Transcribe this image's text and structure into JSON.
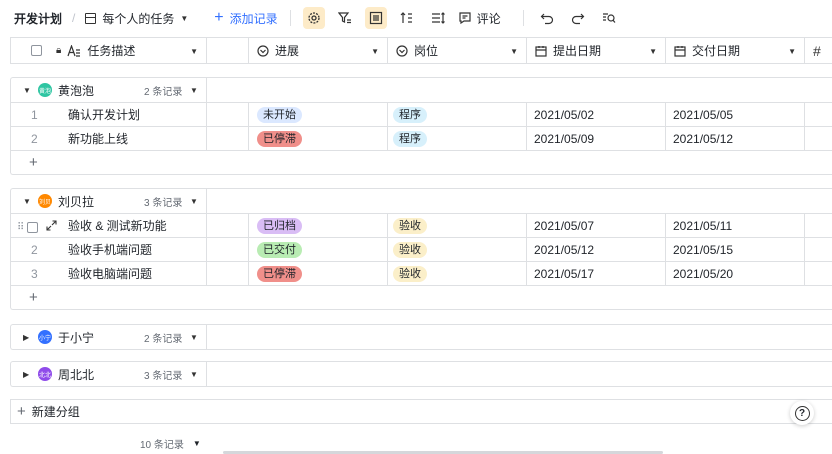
{
  "toolbar": {
    "breadcrumb": "开发计划",
    "separator": "/",
    "view_name": "每个人的任务",
    "add_record": "添加记录",
    "comment": "评论"
  },
  "columns": {
    "task": "任务描述",
    "progress": "进展",
    "role": "岗位",
    "submit_date": "提出日期",
    "deliver_date": "交付日期",
    "extra": "#"
  },
  "groups": [
    {
      "name": "黄泡泡",
      "avatar": "黄泡",
      "avatar_color": "#2ec5a2",
      "count": "2 条记录",
      "expanded": true,
      "rows": [
        {
          "num": "1",
          "task": "确认开发计划",
          "progress": "未开始",
          "progress_color": "#dbe8ff",
          "role": "程序",
          "role_color": "#d7f0fb",
          "submit": "2021/05/02",
          "deliver": "2021/05/05"
        },
        {
          "num": "2",
          "task": "新功能上线",
          "progress": "已停滞",
          "progress_color": "#f08f8a",
          "role": "程序",
          "role_color": "#d7f0fb",
          "submit": "2021/05/09",
          "deliver": "2021/05/12"
        }
      ]
    },
    {
      "name": "刘贝拉",
      "avatar": "刘贝",
      "avatar_color": "#ff8800",
      "count": "3 条记录",
      "expanded": true,
      "rows": [
        {
          "num": "",
          "task": "验收 & 测试新功能",
          "progress": "已归档",
          "progress_color": "#d9bdf5",
          "role": "验收",
          "role_color": "#fbefc9",
          "submit": "2021/05/07",
          "deliver": "2021/05/11"
        },
        {
          "num": "2",
          "task": "验收手机端问题",
          "progress": "已交付",
          "progress_color": "#b9ecb3",
          "role": "验收",
          "role_color": "#fbefc9",
          "submit": "2021/05/12",
          "deliver": "2021/05/15"
        },
        {
          "num": "3",
          "task": "验收电脑端问题",
          "progress": "已停滞",
          "progress_color": "#f08f8a",
          "role": "验收",
          "role_color": "#fbefc9",
          "submit": "2021/05/17",
          "deliver": "2021/05/20"
        }
      ]
    },
    {
      "name": "于小宁",
      "avatar": "小宁",
      "avatar_color": "#3370ff",
      "count": "2 条记录",
      "expanded": false
    },
    {
      "name": "周北北",
      "avatar": "北北",
      "avatar_color": "#8f4bea",
      "count": "3 条记录",
      "expanded": false
    }
  ],
  "new_group": "新建分组",
  "footer": {
    "total": "10 条记录"
  },
  "help": "?"
}
